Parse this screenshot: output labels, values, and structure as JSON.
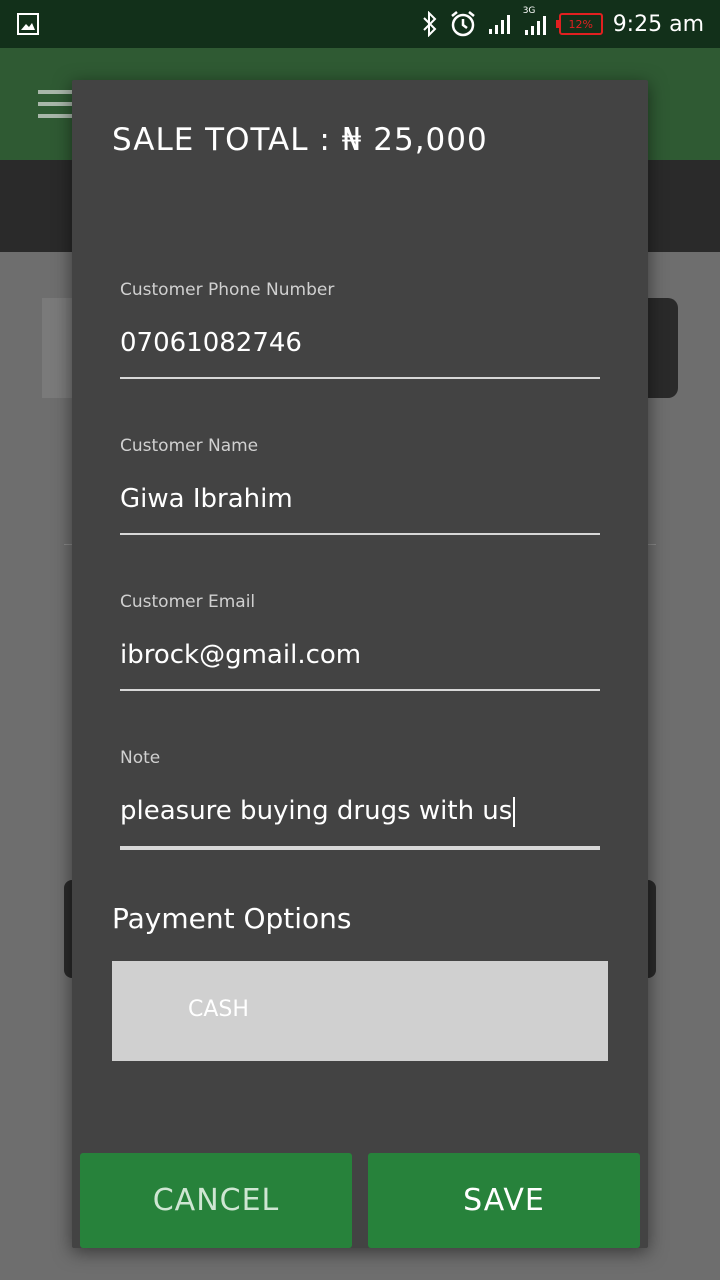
{
  "status_bar": {
    "time": "9:25 am",
    "battery": "12%",
    "network_label": "3G",
    "icons": [
      "image-icon",
      "bluetooth-icon",
      "alarm-icon",
      "signal-icon",
      "signal-3g-icon",
      "battery-icon"
    ]
  },
  "dialog": {
    "title": "SALE TOTAL : ₦ 25,000",
    "fields": [
      {
        "label": "Customer Phone Number",
        "value": "07061082746"
      },
      {
        "label": "Customer Name",
        "value": "Giwa Ibrahim"
      },
      {
        "label": "Customer Email",
        "value": "ibrock@gmail.com"
      },
      {
        "label": "Note",
        "value": "pleasure buying drugs with us"
      }
    ],
    "payment_title": "Payment Options",
    "payment_selected": "CASH",
    "cancel_label": "CANCEL",
    "save_label": "SAVE"
  },
  "colors": {
    "dialog_bg": "#434343",
    "button_green": "#27823b",
    "status_bar": "#12301a",
    "app_bar": "#2f5a33",
    "battery_low": "#e02020"
  }
}
